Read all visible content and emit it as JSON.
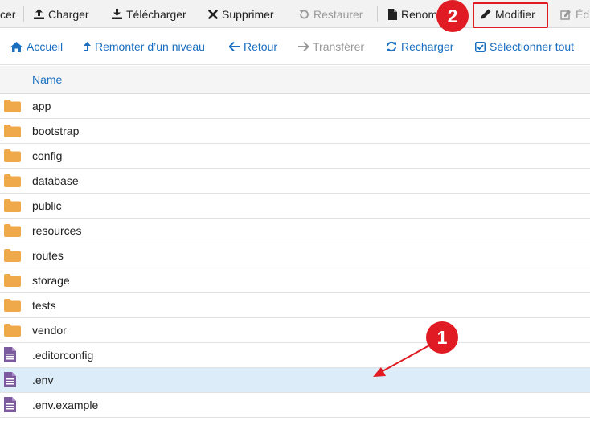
{
  "toolbar": {
    "items": [
      {
        "label": "cer",
        "icon": "",
        "disabled": false
      },
      {
        "label": "Charger",
        "icon": "upload-icon",
        "disabled": false
      },
      {
        "label": "Télécharger",
        "icon": "download-icon",
        "disabled": false
      },
      {
        "label": "Supprimer",
        "icon": "close-icon",
        "disabled": false
      },
      {
        "label": "Restaurer",
        "icon": "undo-icon",
        "disabled": true
      },
      {
        "label": "Renom",
        "icon": "file-icon",
        "disabled": false
      },
      {
        "label": "Modifier",
        "icon": "pencil-icon",
        "disabled": false
      },
      {
        "label": "Édi",
        "icon": "edit-box-icon",
        "disabled": true
      }
    ]
  },
  "nav": {
    "items": [
      {
        "label": "Accueil",
        "icon": "home-icon",
        "disabled": false
      },
      {
        "label": "Remonter d’un niveau",
        "icon": "level-up-icon",
        "disabled": false
      },
      {
        "label": "Retour",
        "icon": "arrow-left-icon",
        "disabled": false
      },
      {
        "label": "Transférer",
        "icon": "arrow-right-icon",
        "disabled": true
      },
      {
        "label": "Recharger",
        "icon": "refresh-icon",
        "disabled": false
      },
      {
        "label": "Sélectionner tout",
        "icon": "check-square-icon",
        "disabled": false
      }
    ]
  },
  "table": {
    "header": "Name",
    "rows": [
      {
        "name": "app",
        "type": "folder"
      },
      {
        "name": "bootstrap",
        "type": "folder"
      },
      {
        "name": "config",
        "type": "folder"
      },
      {
        "name": "database",
        "type": "folder"
      },
      {
        "name": "public",
        "type": "folder"
      },
      {
        "name": "resources",
        "type": "folder"
      },
      {
        "name": "routes",
        "type": "folder"
      },
      {
        "name": "storage",
        "type": "folder"
      },
      {
        "name": "tests",
        "type": "folder"
      },
      {
        "name": "vendor",
        "type": "folder"
      },
      {
        "name": ".editorconfig",
        "type": "file"
      },
      {
        "name": ".env",
        "type": "file",
        "selected": true
      },
      {
        "name": ".env.example",
        "type": "file"
      }
    ]
  },
  "annotations": {
    "badge1": "1",
    "badge2": "2"
  },
  "colors": {
    "accent": "#1a6fc1",
    "annotation": "#e01b24",
    "folder": "#f0a94a",
    "file": "#7b5a9e",
    "selected_row": "#dcecf9"
  }
}
